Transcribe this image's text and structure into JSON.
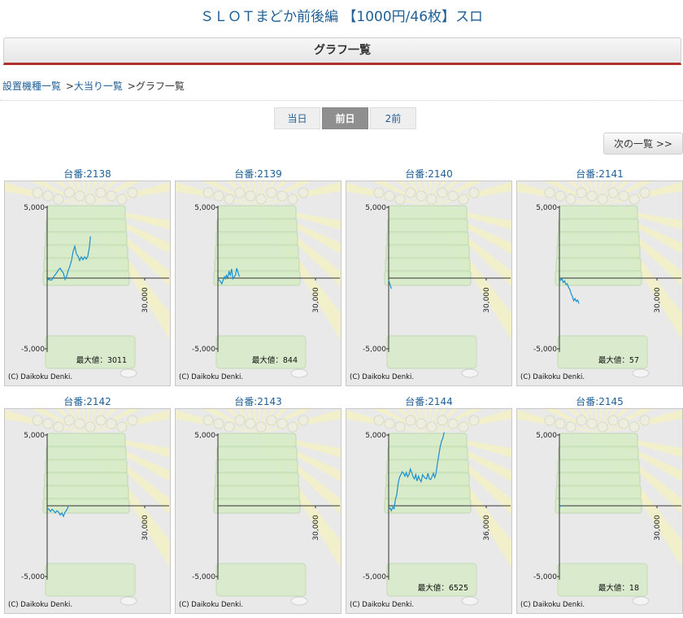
{
  "header": {
    "machine_title": "ＳＬＯＴまどか前後編 【1000円/46枚】スロ"
  },
  "section": {
    "title": "グラフ一覧"
  },
  "breadcrumb": {
    "items": [
      "設置機種一覧",
      "大当り一覧",
      "グラフ一覧"
    ],
    "separator": ">"
  },
  "tabs": [
    {
      "label": "当日",
      "active": false
    },
    {
      "label": "前日",
      "active": true
    },
    {
      "label": "2前",
      "active": false
    }
  ],
  "next_button": {
    "label": "次の一覧 >>"
  },
  "graph": {
    "y_ticks": [
      "5,000",
      "-5,000"
    ],
    "max_prefix": "最大値：",
    "copyright": "(C) Daikoku Denki.",
    "line_color": "#1a8fd0"
  },
  "machines": [
    {
      "number_label": "台番:2138",
      "x_end_label": "30,000",
      "max_value": "3011",
      "series": [
        [
          0,
          -200
        ],
        [
          500,
          -50
        ],
        [
          1000,
          -150
        ],
        [
          1500,
          -120
        ],
        [
          2000,
          100
        ],
        [
          2500,
          250
        ],
        [
          3000,
          400
        ],
        [
          3500,
          600
        ],
        [
          4000,
          700
        ],
        [
          4500,
          500
        ],
        [
          5000,
          350
        ],
        [
          5500,
          -100
        ],
        [
          6000,
          150
        ],
        [
          6500,
          550
        ],
        [
          7000,
          850
        ],
        [
          7500,
          1250
        ],
        [
          8000,
          1900
        ],
        [
          8500,
          2250
        ],
        [
          9000,
          1700
        ],
        [
          9500,
          1550
        ],
        [
          10000,
          1250
        ],
        [
          10500,
          1500
        ],
        [
          11000,
          1300
        ],
        [
          11500,
          1500
        ],
        [
          12000,
          1350
        ],
        [
          12500,
          1550
        ],
        [
          13000,
          2200
        ],
        [
          13300,
          2950
        ]
      ]
    },
    {
      "number_label": "台番:2139",
      "x_end_label": "30,000",
      "max_value": "844",
      "series": [
        [
          0,
          -50
        ],
        [
          400,
          -150
        ],
        [
          800,
          -250
        ],
        [
          1200,
          -400
        ],
        [
          1600,
          -150
        ],
        [
          2000,
          100
        ],
        [
          2300,
          -50
        ],
        [
          2600,
          200
        ],
        [
          3000,
          0
        ],
        [
          3400,
          450
        ],
        [
          3800,
          200
        ],
        [
          4200,
          650
        ],
        [
          4600,
          -50
        ],
        [
          5000,
          100
        ],
        [
          5400,
          200
        ],
        [
          5800,
          700
        ],
        [
          6200,
          400
        ],
        [
          6600,
          100
        ]
      ]
    },
    {
      "number_label": "台番:2140",
      "x_end_label": "30,000",
      "max_value": "",
      "series": [
        [
          0,
          -150
        ],
        [
          200,
          -300
        ],
        [
          500,
          -500
        ],
        [
          800,
          -750
        ]
      ]
    },
    {
      "number_label": "台番:2141",
      "x_end_label": "30,000",
      "max_value": "57",
      "series": [
        [
          0,
          0
        ],
        [
          400,
          -150
        ],
        [
          800,
          -50
        ],
        [
          1200,
          -300
        ],
        [
          1600,
          -200
        ],
        [
          2000,
          -450
        ],
        [
          2400,
          -400
        ],
        [
          2800,
          -650
        ],
        [
          3200,
          -800
        ],
        [
          3600,
          -1100
        ],
        [
          4000,
          -1300
        ],
        [
          4400,
          -1600
        ],
        [
          4800,
          -1450
        ],
        [
          5200,
          -1650
        ],
        [
          5600,
          -1550
        ],
        [
          6000,
          -1800
        ]
      ]
    },
    {
      "number_label": "台番:2142",
      "x_end_label": "30,000",
      "max_value": "",
      "series": [
        [
          0,
          -150
        ],
        [
          500,
          -250
        ],
        [
          1000,
          -400
        ],
        [
          1500,
          -250
        ],
        [
          2000,
          -350
        ],
        [
          2500,
          -500
        ],
        [
          3000,
          -350
        ],
        [
          3500,
          -450
        ],
        [
          4000,
          -650
        ],
        [
          4500,
          -500
        ],
        [
          5000,
          -750
        ],
        [
          5500,
          -450
        ],
        [
          6000,
          -300
        ],
        [
          6500,
          -50
        ]
      ]
    },
    {
      "number_label": "台番:2143",
      "x_end_label": "30,000",
      "max_value": "",
      "series": []
    },
    {
      "number_label": "台番:2144",
      "x_end_label": "36,000",
      "max_value": "6525",
      "series": [
        [
          0,
          -250
        ],
        [
          500,
          -150
        ],
        [
          1000,
          -350
        ],
        [
          1500,
          -100
        ],
        [
          2000,
          -200
        ],
        [
          2500,
          450
        ],
        [
          3000,
          800
        ],
        [
          3500,
          1600
        ],
        [
          4000,
          2000
        ],
        [
          4500,
          2200
        ],
        [
          5000,
          2400
        ],
        [
          5500,
          2300
        ],
        [
          6000,
          2100
        ],
        [
          6500,
          2350
        ],
        [
          7000,
          2050
        ],
        [
          7500,
          2200
        ],
        [
          8000,
          2600
        ],
        [
          8500,
          2350
        ],
        [
          9000,
          2050
        ],
        [
          9500,
          1900
        ],
        [
          10000,
          2200
        ],
        [
          10500,
          1750
        ],
        [
          11000,
          2100
        ],
        [
          11500,
          1850
        ],
        [
          12000,
          1700
        ],
        [
          12500,
          2200
        ],
        [
          13000,
          2050
        ],
        [
          13500,
          1950
        ],
        [
          14000,
          1900
        ],
        [
          14500,
          2300
        ],
        [
          15000,
          1900
        ],
        [
          15500,
          1850
        ],
        [
          16000,
          2050
        ],
        [
          16500,
          2300
        ],
        [
          17000,
          2000
        ],
        [
          17500,
          2300
        ],
        [
          18000,
          3000
        ],
        [
          18500,
          3600
        ],
        [
          19000,
          4150
        ],
        [
          19500,
          4550
        ],
        [
          20000,
          4800
        ],
        [
          20500,
          5200
        ]
      ]
    },
    {
      "number_label": "台番:2145",
      "x_end_label": "30,000",
      "max_value": "18",
      "series": [
        [
          0,
          -100
        ],
        [
          300,
          0
        ],
        [
          600,
          -50
        ]
      ]
    }
  ]
}
